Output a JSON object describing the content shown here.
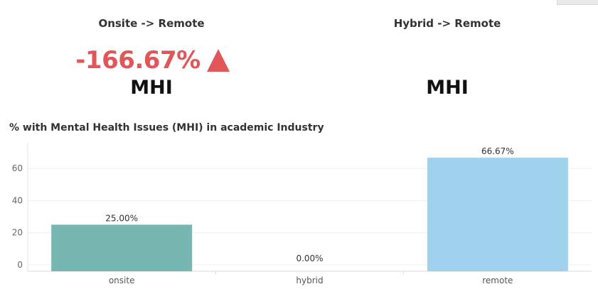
{
  "kpis": [
    {
      "title": "Onsite -> Remote",
      "value": "-166.67%",
      "metric": "MHI",
      "arrow": "up-triangle-icon",
      "color": "#e15759"
    },
    {
      "title": "Hybrid -> Remote",
      "value": "",
      "metric": "MHI"
    }
  ],
  "chart_data": {
    "type": "bar",
    "title": "% with Mental Health Issues (MHI) in academic Industry",
    "categories": [
      "onsite",
      "hybrid",
      "remote"
    ],
    "values": [
      25.0,
      0.0,
      66.67
    ],
    "data_labels": [
      "25.00%",
      "0.00%",
      "66.67%"
    ],
    "colors": [
      "#76b7b2",
      "#4e79a7",
      "#a0d1ed"
    ],
    "xlabel": "",
    "ylabel": "",
    "yticks": [
      0,
      20,
      40,
      60
    ],
    "ylim": [
      -4,
      76
    ],
    "grid": true
  }
}
